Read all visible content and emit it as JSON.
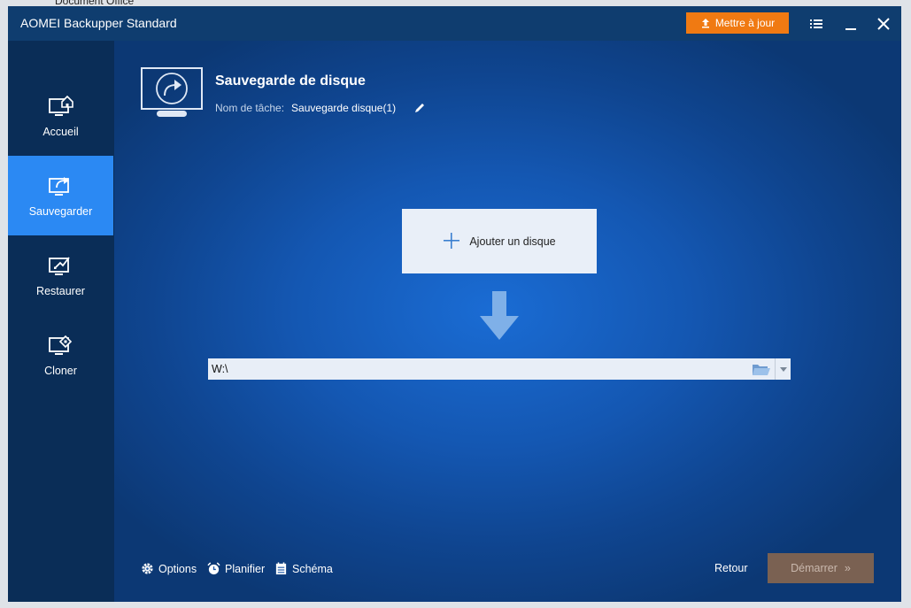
{
  "background_app": {
    "label": "Document Office"
  },
  "window": {
    "title": "AOMEI Backupper Standard",
    "update_label": "Mettre à jour",
    "colors": {
      "accent": "#2b89f3",
      "update": "#f07a12",
      "sidebar": "#0a2d57",
      "start_button": "#7a6152"
    }
  },
  "sidebar": {
    "items": [
      {
        "label": "Accueil",
        "icon": "home-monitor-icon",
        "active": false
      },
      {
        "label": "Sauvegarder",
        "icon": "backup-monitor-icon",
        "active": true
      },
      {
        "label": "Restaurer",
        "icon": "restore-monitor-icon",
        "active": false
      },
      {
        "label": "Cloner",
        "icon": "clone-monitor-icon",
        "active": false
      }
    ]
  },
  "main": {
    "title": "Sauvegarde de disque",
    "task_label": "Nom de tâche:",
    "task_value": "Sauvegarde disque(1)",
    "add_disk_label": "Ajouter un disque",
    "destination_path": "W:\\"
  },
  "footer": {
    "options_label": "Options",
    "schedule_label": "Planifier",
    "scheme_label": "Schéma",
    "back_label": "Retour",
    "start_label": "Démarrer",
    "start_chevrons": "»"
  }
}
